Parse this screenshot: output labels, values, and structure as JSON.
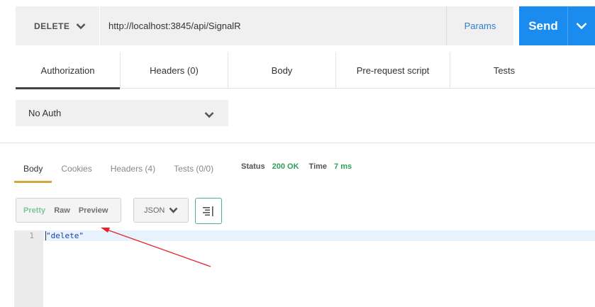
{
  "request": {
    "method": "DELETE",
    "url": "http://localhost:3845/api/SignalR",
    "params_label": "Params",
    "send_label": "Send"
  },
  "request_tabs": [
    {
      "label": "Authorization",
      "active": true
    },
    {
      "label": "Headers (0)",
      "active": false
    },
    {
      "label": "Body",
      "active": false
    },
    {
      "label": "Pre-request script",
      "active": false
    },
    {
      "label": "Tests",
      "active": false
    }
  ],
  "auth": {
    "type": "No Auth"
  },
  "response_tabs": [
    {
      "label": "Body",
      "active": true
    },
    {
      "label": "Cookies",
      "active": false
    },
    {
      "label": "Headers (4)",
      "active": false
    },
    {
      "label": "Tests (0/0)",
      "active": false
    }
  ],
  "status": {
    "status_label": "Status",
    "status_value": "200 OK",
    "time_label": "Time",
    "time_value": "7 ms"
  },
  "format": {
    "modes": [
      "Pretty",
      "Raw",
      "Preview"
    ],
    "active_mode": "Pretty",
    "language": "JSON"
  },
  "response_body": {
    "line_number": "1",
    "content": "\"delete\""
  },
  "colors": {
    "send_button": "#1a8cf0",
    "params_link": "#2d7fd2",
    "status_ok": "#2e9f5e",
    "active_response_tab": "#d4a73b",
    "annotation_arrow": "#e8202a"
  },
  "annotation": {
    "type": "arrow",
    "color": "red",
    "points_to": "format-mode-group"
  }
}
